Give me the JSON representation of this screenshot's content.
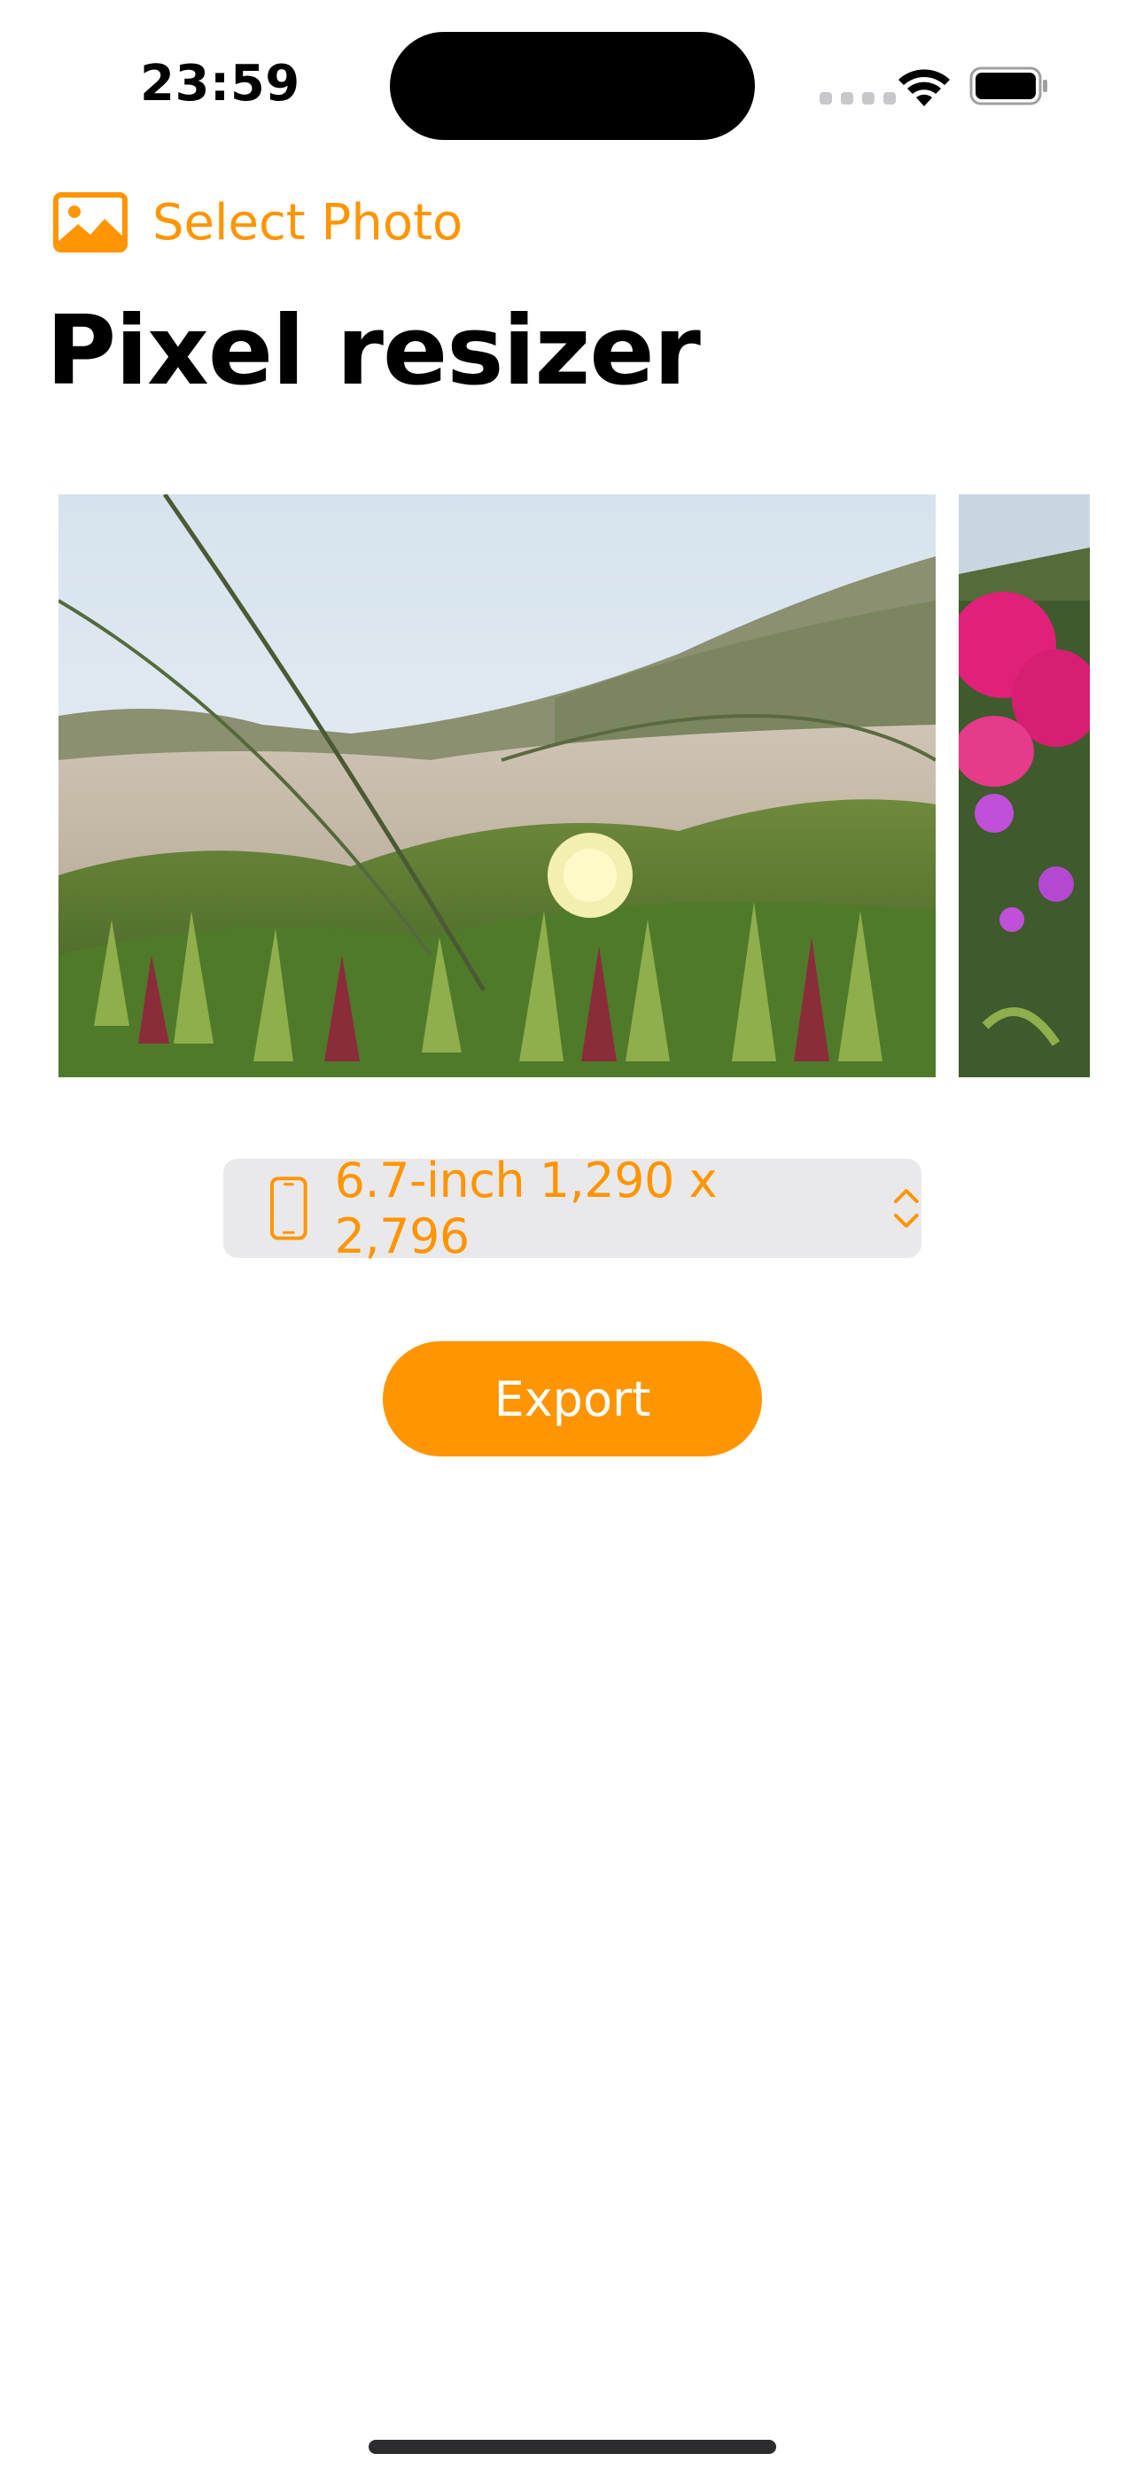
{
  "status_bar": {
    "time": "23:59"
  },
  "header": {
    "select_photo_label": "Select Photo",
    "select_photo_icon": "photo-icon",
    "title": "Pixel resizer"
  },
  "photos": [
    {
      "description_icon": "beach-iceplant-photo"
    },
    {
      "description_icon": "pink-flowers-photo"
    }
  ],
  "device_picker": {
    "selected": "6.7-inch 1,290 x 2,796",
    "icon": "iphone-icon",
    "chevron": "chevron-up-down-icon"
  },
  "export": {
    "label": "Export"
  },
  "colors": {
    "accent": "#ff9500",
    "picker_background": "#e9e9eb"
  }
}
